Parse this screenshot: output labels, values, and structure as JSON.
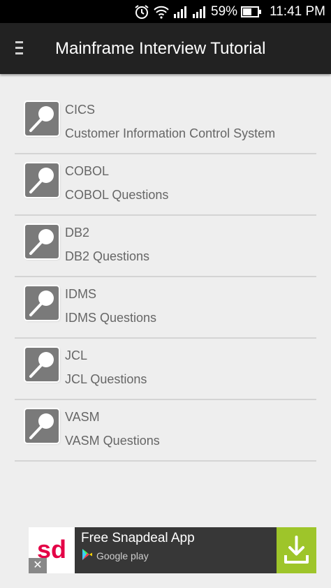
{
  "status_bar": {
    "battery": "59%",
    "time": "11:41 PM"
  },
  "app": {
    "title": "Mainframe Interview Tutorial",
    "menu_icon": "hamburger-menu-icon"
  },
  "items": [
    {
      "title": "CICS",
      "subtitle": "Customer Information Control System",
      "icon": "magnifier-icon"
    },
    {
      "title": "COBOL",
      "subtitle": "COBOL Questions",
      "icon": "magnifier-icon"
    },
    {
      "title": "DB2",
      "subtitle": "DB2 Questions",
      "icon": "magnifier-icon"
    },
    {
      "title": "IDMS",
      "subtitle": "IDMS Questions",
      "icon": "magnifier-icon"
    },
    {
      "title": "JCL",
      "subtitle": "JCL Questions",
      "icon": "magnifier-icon"
    },
    {
      "title": "VASM",
      "subtitle": "VASM Questions",
      "icon": "magnifier-icon"
    }
  ],
  "ad": {
    "title": "Free Snapdeal App",
    "store": "Google play",
    "logo_text": "sd",
    "close_label": "✕",
    "colors": {
      "logo_red": "#e40046",
      "download_green": "#9ec52a"
    }
  },
  "colors": {
    "toolbar": "#222222",
    "background": "#eeeeee"
  }
}
